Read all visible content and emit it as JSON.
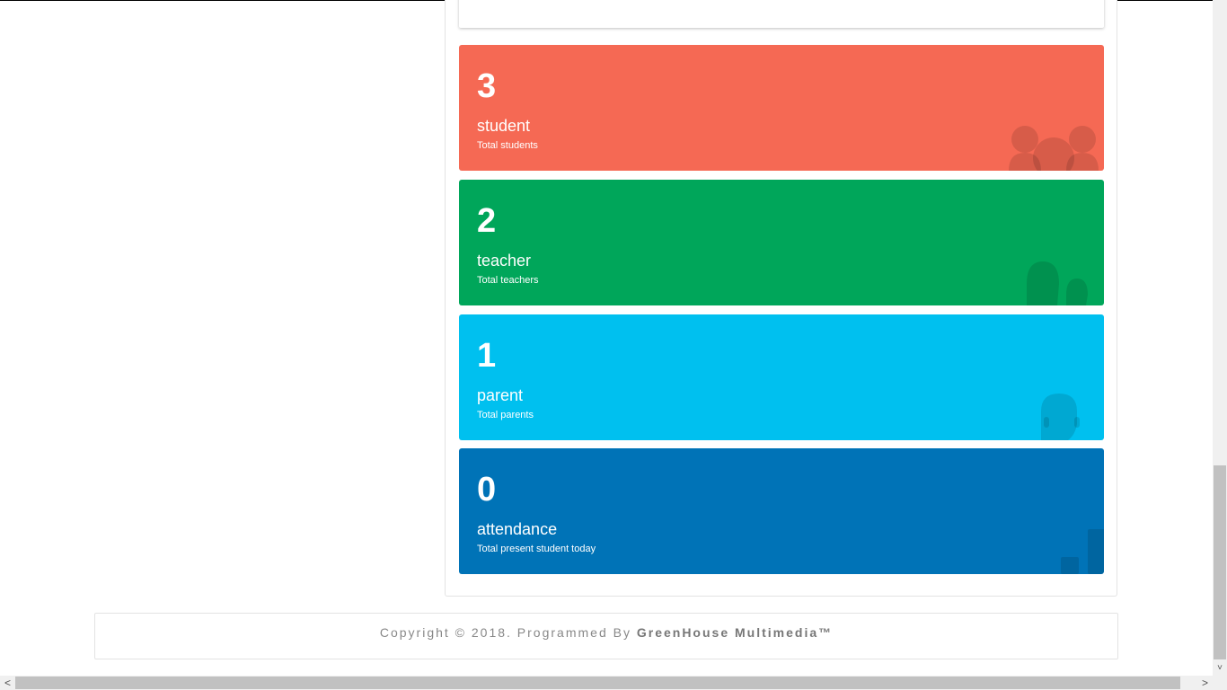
{
  "tiles": [
    {
      "number": "3",
      "title": "student",
      "desc": "Total students",
      "color": "#f56954",
      "icon": "users-icon"
    },
    {
      "number": "2",
      "title": "teacher",
      "desc": "Total teachers",
      "color": "#00a65a",
      "icon": "teachers-icon"
    },
    {
      "number": "1",
      "title": "parent",
      "desc": "Total parents",
      "color": "#00c0ef",
      "icon": "user-icon"
    },
    {
      "number": "0",
      "title": "attendance",
      "desc": "Total present student today",
      "color": "#0073b7",
      "icon": "bar-chart-icon"
    }
  ],
  "footer": {
    "prefix": "Copyright © 2018. Programmed By ",
    "company": "GreenHouse Multimedia™"
  },
  "scrollbars": {
    "up_arrow": "˄",
    "down_arrow": "˅",
    "left_arrow": "<",
    "right_arrow": ">"
  }
}
